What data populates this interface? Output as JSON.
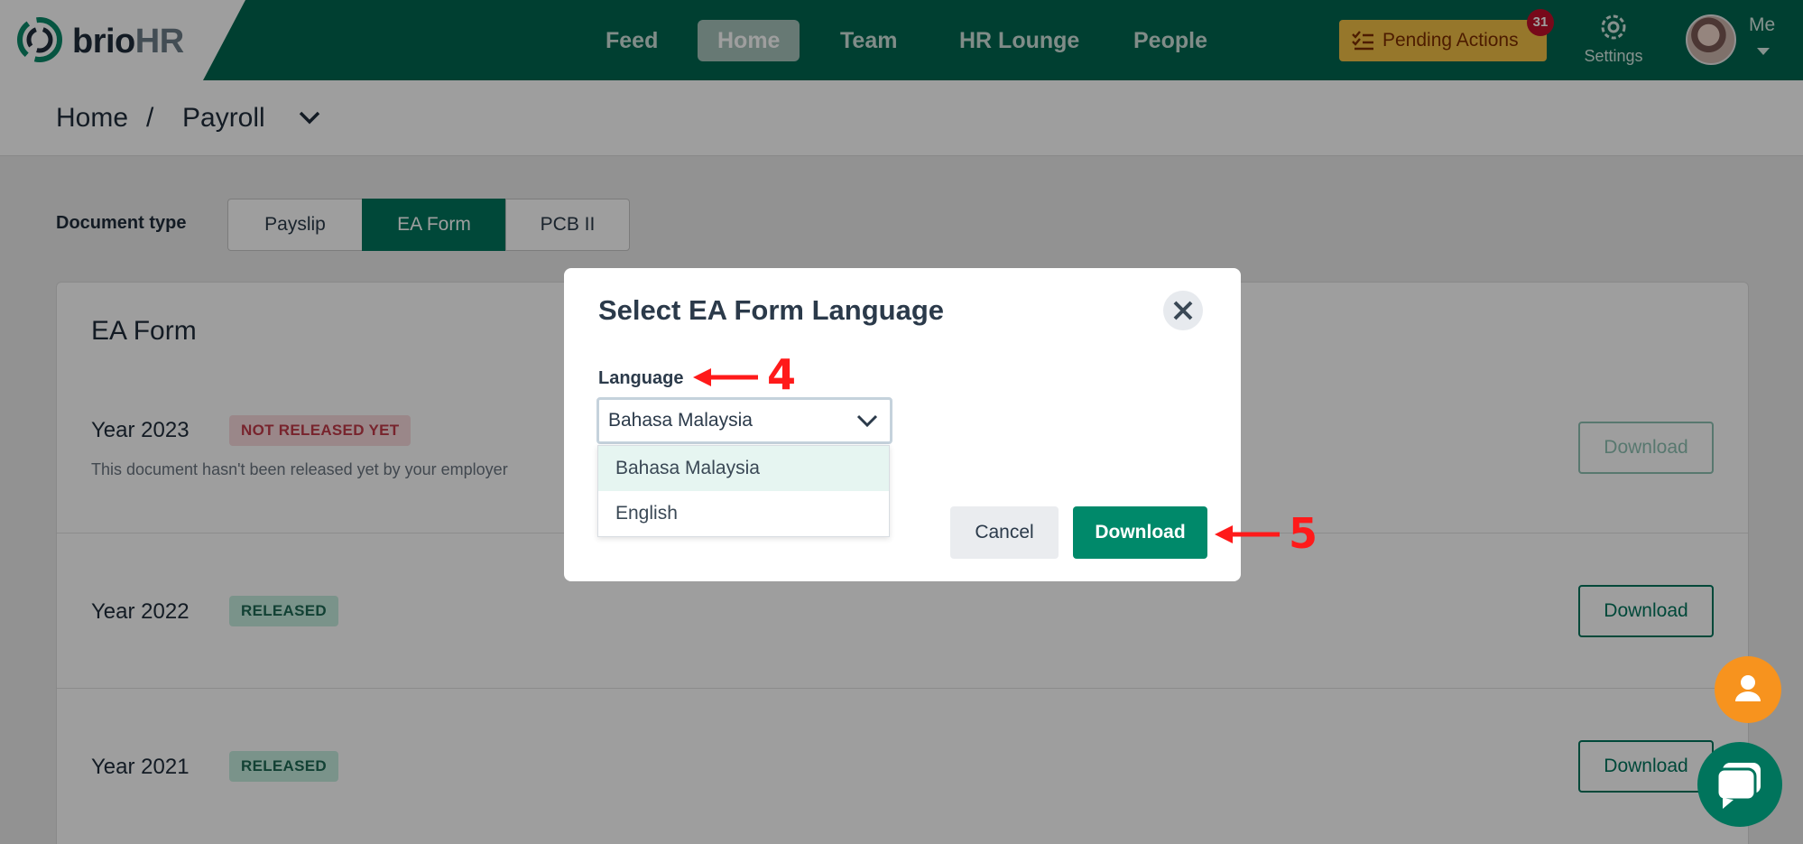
{
  "brand": {
    "name_main": "brio",
    "name_accent": "HR"
  },
  "nav": {
    "items": [
      {
        "label": "Feed",
        "active": false
      },
      {
        "label": "Home",
        "active": true
      },
      {
        "label": "Team",
        "active": false
      },
      {
        "label": "HR Lounge",
        "active": false
      },
      {
        "label": "People",
        "active": false
      }
    ],
    "pending_actions": {
      "label": "Pending Actions",
      "count": "31"
    },
    "settings_label": "Settings",
    "user_label": "Me"
  },
  "breadcrumb": {
    "home": "Home",
    "separator": "/",
    "current": "Payroll"
  },
  "document_type": {
    "label": "Document type",
    "options": [
      "Payslip",
      "EA Form",
      "PCB II"
    ],
    "selected": "EA Form"
  },
  "card": {
    "title": "EA Form",
    "rows": [
      {
        "year": "Year 2023",
        "status": "NOT RELEASED YET",
        "note": "This document hasn't been released yet by your employer",
        "action": "Download"
      },
      {
        "year": "Year 2022",
        "status": "RELEASED",
        "action": "Download"
      },
      {
        "year": "Year 2021",
        "status": "RELEASED",
        "action": "Download"
      }
    ]
  },
  "modal": {
    "title": "Select EA Form Language",
    "language_label": "Language",
    "selected_language": "Bahasa Malaysia",
    "options": [
      "Bahasa Malaysia",
      "English"
    ],
    "cancel_label": "Cancel",
    "download_label": "Download"
  },
  "annotations": {
    "step_language": "4",
    "step_download": "5"
  },
  "colors": {
    "brand_green": "#00664f",
    "primary_button": "#00896a",
    "pending_bg": "#f3c146",
    "badge_red": "#c1102a",
    "annotation_red": "#ff1a1a",
    "fab_orange": "#f7931e"
  }
}
